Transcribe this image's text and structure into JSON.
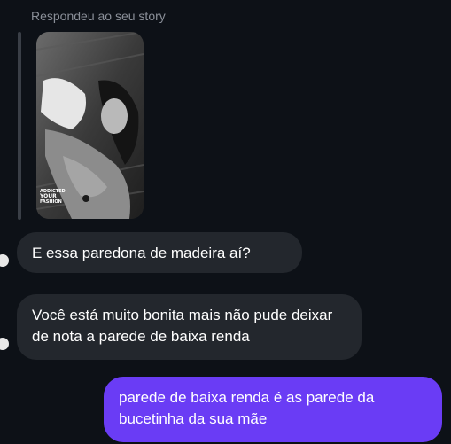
{
  "reply_header": "Respondeu ao seu story",
  "story": {
    "caption_line1": "ADDICTED",
    "caption_line2": "YOUR",
    "caption_line3": "FASHION"
  },
  "messages": [
    {
      "direction": "incoming",
      "text": "E essa paredona de madeira aí?"
    },
    {
      "direction": "incoming",
      "text": "Você está muito bonita mais não pude deixar de nota a parede de baixa renda"
    },
    {
      "direction": "outgoing",
      "text": "parede de baixa renda é as parede da bucetinha da sua mãe"
    }
  ],
  "colors": {
    "background": "#0d1117",
    "incoming_bubble": "#23272d",
    "outgoing_bubble": "#6a3cf5"
  }
}
